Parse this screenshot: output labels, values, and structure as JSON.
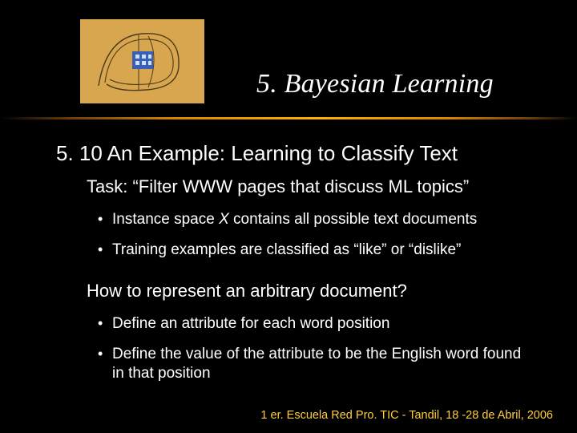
{
  "title": "5. Bayesian Learning",
  "subtitle": "5. 10 An Example: Learning to Classify Text",
  "task": "Task: “Filter WWW pages that discuss ML topics”",
  "bullets_a": [
    "Instance space X contains all possible text documents",
    "Training examples are classified as “like” or “dislike”"
  ],
  "question": "How to represent an arbitrary document?",
  "bullets_b": [
    "Define an attribute for each word position",
    "Define the value of the attribute to be the English word found in that position"
  ],
  "footer": "1 er. Escuela Red Pro. TIC - Tandil, 18 -28 de Abril, 2006"
}
